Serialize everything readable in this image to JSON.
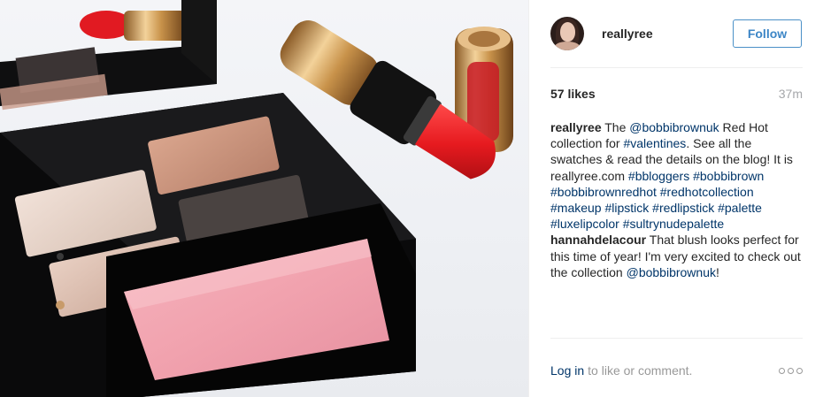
{
  "photo": {
    "alt_subject": "makeup-palette-and-lipstick"
  },
  "header": {
    "username": "reallyree",
    "follow_label": "Follow"
  },
  "stats": {
    "likes": "57 likes",
    "time": "37m"
  },
  "caption": {
    "username": "reallyree",
    "segments": [
      {
        "t": " The ",
        "link": false
      },
      {
        "t": "@bobbibrownuk",
        "link": true
      },
      {
        "t": " Red Hot collection for ",
        "link": false
      },
      {
        "t": "#valentines",
        "link": true
      },
      {
        "t": ". See all the swatches & read the details on the blog! It is reallyree.com ",
        "link": false
      },
      {
        "t": "#bbloggers",
        "link": true
      },
      {
        "t": " ",
        "link": false
      },
      {
        "t": "#bobbibrown",
        "link": true
      },
      {
        "t": " ",
        "link": false
      },
      {
        "t": "#bobbibrownredhot",
        "link": true
      },
      {
        "t": " ",
        "link": false
      },
      {
        "t": "#redhotcollection",
        "link": true
      },
      {
        "t": " ",
        "link": false
      },
      {
        "t": "#makeup",
        "link": true
      },
      {
        "t": " ",
        "link": false
      },
      {
        "t": "#lipstick",
        "link": true
      },
      {
        "t": " ",
        "link": false
      },
      {
        "t": "#redlipstick",
        "link": true
      },
      {
        "t": " ",
        "link": false
      },
      {
        "t": "#palette",
        "link": true
      },
      {
        "t": " ",
        "link": false
      },
      {
        "t": "#luxelipcolor",
        "link": true
      },
      {
        "t": " ",
        "link": false
      },
      {
        "t": "#sultrynudepalette",
        "link": true
      }
    ]
  },
  "comment": {
    "username": "hannahdelacour",
    "segments": [
      {
        "t": " That blush looks perfect for this time of year! I'm very excited to check out the collection ",
        "link": false
      },
      {
        "t": "@bobbibrownuk",
        "link": true
      },
      {
        "t": "!",
        "link": false
      }
    ]
  },
  "footer": {
    "login_label": "Log in",
    "rest_label": "to like or comment."
  },
  "colors": {
    "link": "#003569",
    "follow_border": "#4a90c7",
    "muted": "#999999"
  }
}
